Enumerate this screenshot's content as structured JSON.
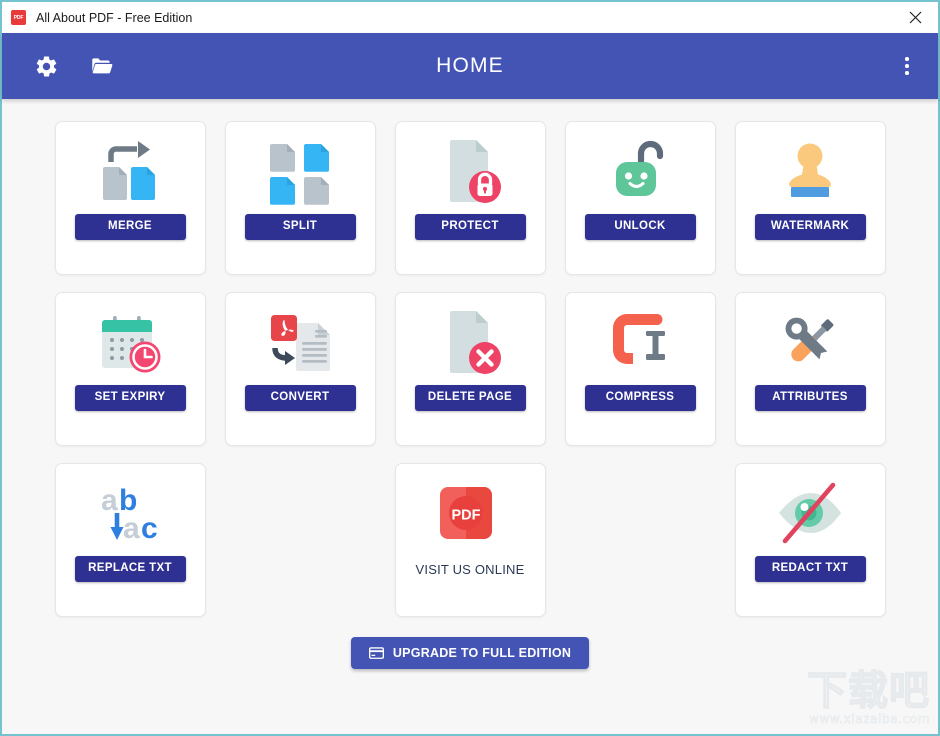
{
  "window": {
    "title": "All About PDF - Free Edition",
    "app_icon": "pdf-icon",
    "app_icon_text": "PDF",
    "close_icon": "close-icon",
    "border_color": "#74c3cf"
  },
  "header": {
    "title": "HOME",
    "background": "#4354b5",
    "gear_icon": "gear-icon",
    "folder_icon": "folder-open-icon",
    "menu_icon": "more-vertical-icon"
  },
  "theme": {
    "button_color": "#2e3192",
    "accent": "#4354b5",
    "content_background": "#f7f7f8",
    "card_background": "#ffffff"
  },
  "tools": [
    [
      {
        "id": "merge",
        "label": "MERGE",
        "icon": "merge-documents-icon",
        "style": "button"
      },
      {
        "id": "split",
        "label": "SPLIT",
        "icon": "split-documents-icon",
        "style": "button"
      },
      {
        "id": "protect",
        "label": "PROTECT",
        "icon": "document-lock-icon",
        "style": "button"
      },
      {
        "id": "unlock",
        "label": "UNLOCK",
        "icon": "open-padlock-icon",
        "style": "button"
      },
      {
        "id": "watermark",
        "label": "WATERMARK",
        "icon": "rubber-stamp-icon",
        "style": "button"
      }
    ],
    [
      {
        "id": "set-expiry",
        "label": "SET EXPIRY",
        "icon": "calendar-clock-icon",
        "style": "button"
      },
      {
        "id": "convert",
        "label": "CONVERT",
        "icon": "pdf-convert-icon",
        "style": "button"
      },
      {
        "id": "delete-page",
        "label": "DELETE PAGE",
        "icon": "document-delete-icon",
        "style": "button"
      },
      {
        "id": "compress",
        "label": "COMPRESS",
        "icon": "clamp-icon",
        "style": "button"
      },
      {
        "id": "attributes",
        "label": "ATTRIBUTES",
        "icon": "screwdriver-wrench-icon",
        "style": "button"
      }
    ],
    [
      {
        "id": "replace-txt",
        "label": "REPLACE TXT",
        "icon": "replace-text-icon",
        "style": "button"
      },
      {
        "id": "spacer-1",
        "label": "",
        "icon": "",
        "style": "spacer"
      },
      {
        "id": "visit-online",
        "label": "VISIT US ONLINE",
        "icon": "pdf-badge-icon",
        "style": "plain"
      },
      {
        "id": "spacer-2",
        "label": "",
        "icon": "",
        "style": "spacer"
      },
      {
        "id": "redact-txt",
        "label": "REDACT TXT",
        "icon": "eye-slash-icon",
        "style": "button"
      }
    ]
  ],
  "footer": {
    "upgrade_label": "UPGRADE TO FULL EDITION",
    "upgrade_icon": "credit-card-icon"
  },
  "watermark": {
    "main": "下载吧",
    "sub": "www.xiazaiba.com"
  }
}
